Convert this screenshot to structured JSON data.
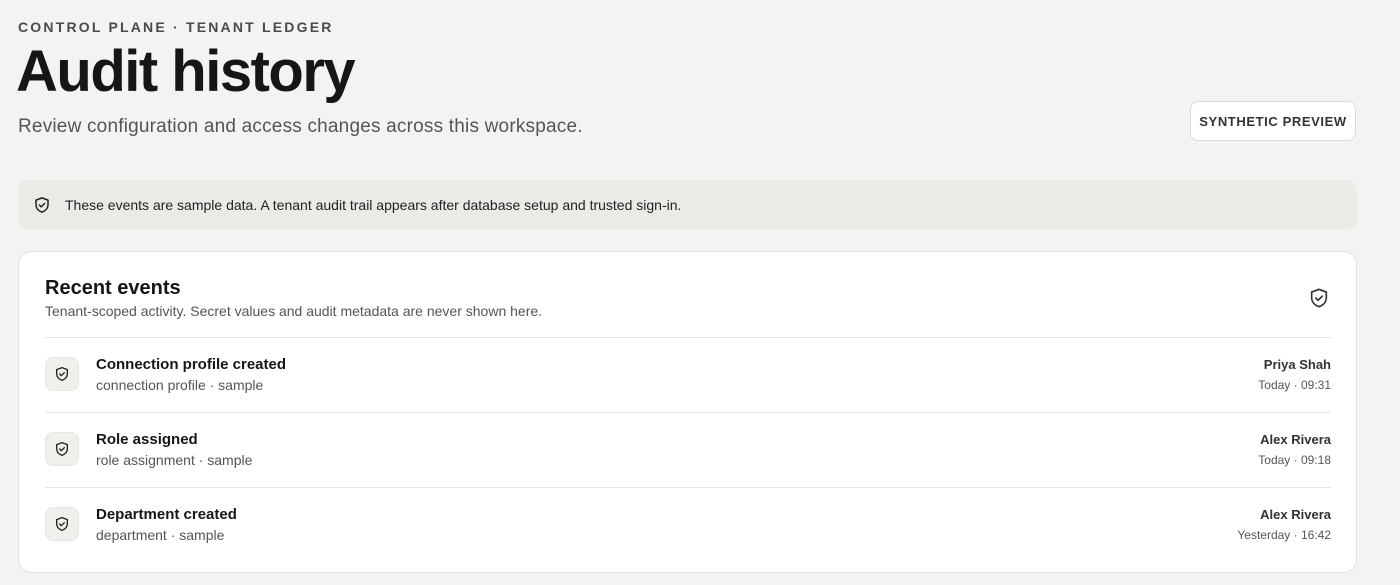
{
  "header": {
    "eyebrow": "CONTROL PLANE · TENANT LEDGER",
    "title": "Audit history",
    "subtitle": "Review configuration and access changes across this workspace.",
    "preview_label": "SYNTHETIC PREVIEW"
  },
  "banner": {
    "icon": "shield-check-icon",
    "text": "These events are sample data. A tenant audit trail appears after database setup and trusted sign-in."
  },
  "recent_events": {
    "title": "Recent events",
    "subtitle": "Tenant-scoped activity. Secret values and audit metadata are never shown here.",
    "icon": "shield-check-icon",
    "items": [
      {
        "title": "Connection profile created",
        "meta": "connection profile · sample",
        "actor": "Priya Shah",
        "time": "Today · 09:31",
        "icon": "shield-check-icon"
      },
      {
        "title": "Role assigned",
        "meta": "role assignment · sample",
        "actor": "Alex Rivera",
        "time": "Today · 09:18",
        "icon": "shield-check-icon"
      },
      {
        "title": "Department created",
        "meta": "department · sample",
        "actor": "Alex Rivera",
        "time": "Yesterday · 16:42",
        "icon": "shield-check-icon"
      }
    ]
  },
  "colors": {
    "background": "#f4f3f1",
    "card": "#ffffff",
    "banner": "#ebeae7",
    "text_primary": "#161616",
    "text_secondary": "#555555"
  }
}
